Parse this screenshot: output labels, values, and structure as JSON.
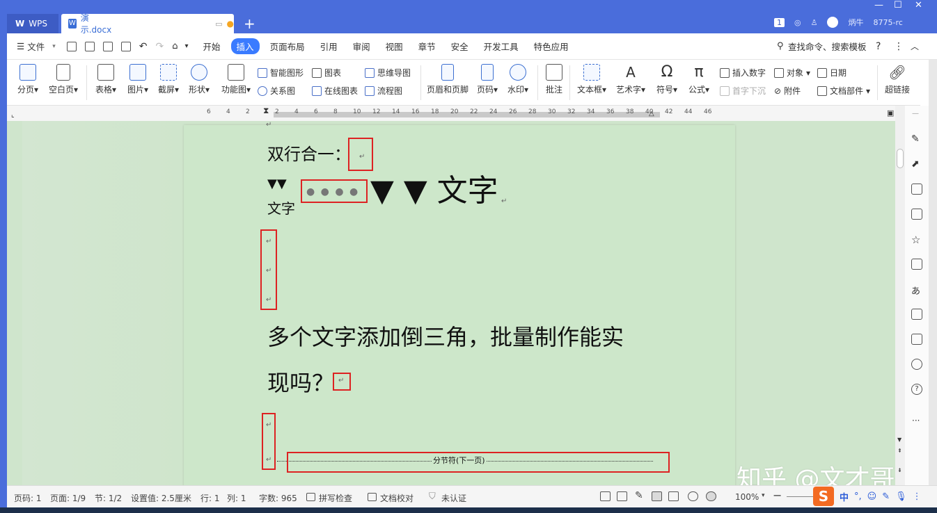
{
  "window": {
    "app_tab": "WPS",
    "doc_tab": "演示.docx",
    "user_name": "炳牛",
    "user_id": "8775-rc",
    "notification_count": "1",
    "minimize_glyph": "—",
    "maximize_glyph": "☐",
    "close_glyph": "✕"
  },
  "menubar": {
    "file": "文件",
    "items": [
      "开始",
      "插入",
      "页面布局",
      "引用",
      "审阅",
      "视图",
      "章节",
      "安全",
      "开发工具",
      "特色应用"
    ],
    "active": "插入",
    "search": "查找命令、搜索模板",
    "help": "?"
  },
  "ribbon": {
    "page_break": "分页",
    "blank_page": "空白页",
    "table": "表格",
    "picture": "图片",
    "screenshot": "截屏",
    "shape": "形状",
    "function_chart": "功能图",
    "smart_shape": "智能图形",
    "chart": "图表",
    "mind_map": "思维导图",
    "relation_map": "关系图",
    "online_chart": "在线图表",
    "flowchart": "流程图",
    "header_footer": "页眉和页脚",
    "page_number": "页码",
    "watermark": "水印",
    "comment": "批注",
    "textbox": "文本框",
    "wordart": "艺术字",
    "symbol": "符号",
    "formula": "公式",
    "insert_number": "插入数字",
    "object": "对象",
    "date": "日期",
    "drop_cap": "首字下沉",
    "attachment": "附件",
    "doc_parts": "文档部件",
    "hyperlink": "超链接"
  },
  "ruler": {
    "ticks": [
      "6",
      "4",
      "2",
      "2",
      "4",
      "6",
      "8",
      "10",
      "12",
      "14",
      "16",
      "18",
      "20",
      "22",
      "24",
      "26",
      "28",
      "30",
      "32",
      "34",
      "36",
      "38",
      "40",
      "42",
      "44",
      "46"
    ]
  },
  "document": {
    "line1": "双行合一：",
    "line2_triangles_small": "▼▼",
    "line2_sub": "文字",
    "line2_dots": "● ● ● ●",
    "line2_big": "▼ ▼ 文字",
    "para_line1": "多个文字添加倒三角，批量制作能实",
    "para_line2": "现吗？",
    "section_break": "分节符(下一页)",
    "paragraph_mark": "↵"
  },
  "statusbar": {
    "page_num": "页码: 1",
    "page": "页面: 1/9",
    "section": "节: 1/2",
    "setting": "设置值: 2.5厘米",
    "row": "行: 1",
    "col": "列: 1",
    "word_count": "字数: 965",
    "spellcheck": "拼写检查",
    "proofread": "文档校对",
    "uncertified": "未认证",
    "zoom": "100%"
  },
  "ime": {
    "logo": "S",
    "lang": "中",
    "punct": "°,"
  },
  "watermark_text": "知乎 @文才哥",
  "colors": {
    "titlebar": "#4a6ddb",
    "active_tab": "#3a7bff",
    "doc_bg": "#cfe5cc",
    "highlight_box": "#dd2222"
  }
}
